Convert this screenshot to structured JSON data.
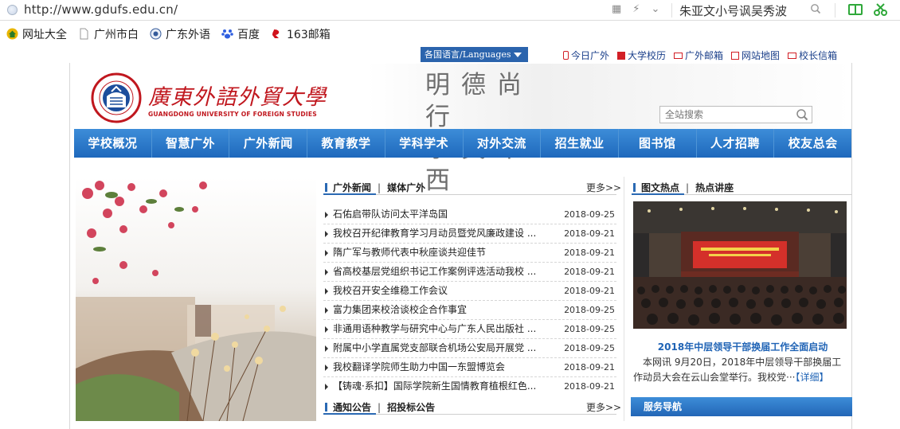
{
  "browser": {
    "url": "http://www.gdufs.edu.cn/",
    "search_query": "朱亚文小号讽吴秀波",
    "bookmarks": [
      {
        "label": "网址大全",
        "icon": "bookmark-home-icon"
      },
      {
        "label": "广州市白",
        "icon": "page-icon"
      },
      {
        "label": "广东外语",
        "icon": "globe-icon"
      },
      {
        "label": "百度",
        "icon": "baidu-paw-icon"
      },
      {
        "label": "163邮箱",
        "icon": "mail-163-icon"
      }
    ]
  },
  "topbar": {
    "language": "各国语言/Languages",
    "links": [
      "今日广外",
      "大学校历",
      "广外邮箱",
      "网站地图",
      "校长信箱"
    ]
  },
  "header": {
    "logo_cn": "廣東外語外貿大學",
    "logo_en": "GUANGDONG UNIVERSITY OF FOREIGN STUDIES",
    "motto_line1": "明德尚行",
    "motto_line2": "學貫中西",
    "search_placeholder": "全站搜索"
  },
  "nav": [
    "学校概况",
    "智慧广外",
    "广外新闻",
    "教育教学",
    "学科学术",
    "对外交流",
    "招生就业",
    "图书馆",
    "人才招聘",
    "校友总会"
  ],
  "news": {
    "tab_active": "广外新闻",
    "tab_other": "媒体广外",
    "more": "更多>>",
    "items": [
      {
        "title": "石佑启带队访问太平洋岛国",
        "date": "2018-09-25"
      },
      {
        "title": "我校召开纪律教育学习月动员暨党风廉政建设 ...",
        "date": "2018-09-21"
      },
      {
        "title": "隋广军与教师代表中秋座谈共迎佳节",
        "date": "2018-09-21"
      },
      {
        "title": "省高校基层党组织书记工作案例评选活动我校 ...",
        "date": "2018-09-21"
      },
      {
        "title": "我校召开安全维稳工作会议",
        "date": "2018-09-21"
      },
      {
        "title": "富力集团来校洽谈校企合作事宜",
        "date": "2018-09-25"
      },
      {
        "title": "非通用语种教学与研究中心与广东人民出版社 ...",
        "date": "2018-09-25"
      },
      {
        "title": "附属中小学直属党支部联合机场公安局开展党 ...",
        "date": "2018-09-25"
      },
      {
        "title": "我校翻译学院师生助力中国一东盟博览会",
        "date": "2018-09-21"
      },
      {
        "title": "【铸魂·系扣】国际学院新生国情教育植根红色...",
        "date": "2018-09-21"
      }
    ]
  },
  "notices": {
    "tab_active": "通知公告",
    "tab_other": "招投标公告",
    "more": "更多>>"
  },
  "photo_news": {
    "tab_active": "图文热点",
    "tab_other": "热点讲座",
    "headline": "2018年中层领导干部换届工作全面启动",
    "body": "本网讯 9月20日，2018年中层领导干部换届工作动员大会在云山会堂举行。我校党···",
    "detail_link": "【详细】"
  },
  "service": {
    "title": "服务导航"
  },
  "colors": {
    "nav_blue": "#2a69b3",
    "brand_red": "#c0171e",
    "link_blue": "#1f63b5"
  }
}
